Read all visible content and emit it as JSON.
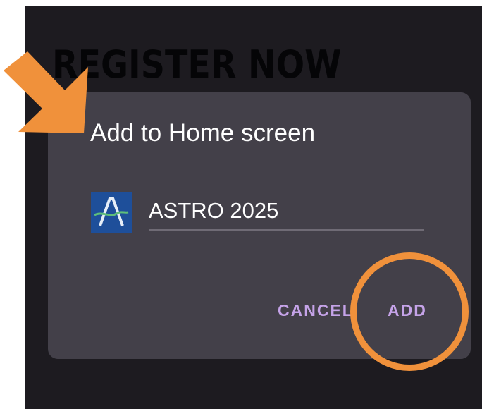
{
  "background": {
    "heading": "REGISTER NOW"
  },
  "dialog": {
    "title": "Add to Home screen",
    "app_icon": "astro-logo-icon",
    "app_name_value": "ASTRO 2025",
    "buttons": {
      "cancel_label": "CANCEL",
      "add_label": "ADD"
    }
  },
  "annotations": {
    "arrow": "arrow-icon",
    "highlight": "circle-highlight"
  },
  "colors": {
    "screen_bg": "#1d1b20",
    "dialog_bg": "#434049",
    "button_text": "#c5a3e8",
    "annotation": "#f0913b"
  }
}
